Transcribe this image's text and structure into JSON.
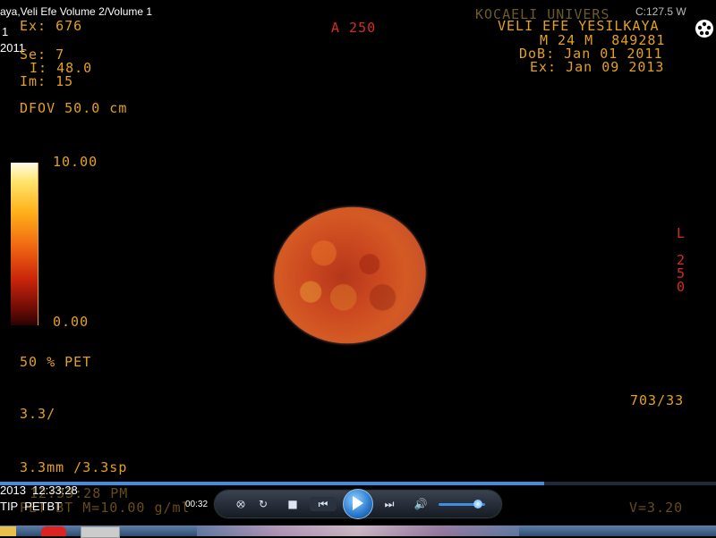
{
  "viewer": {
    "title_left": "aya,Veli Efe Volume 2/Volume 1",
    "institution": "KOCAELI UNIVERS",
    "window_level_fragment": "C:127.5 W",
    "exam_number": "Ex: 676",
    "series": "Se: 7",
    "image_index": "I: 48.0",
    "image_number": "Im: 15",
    "dfov": "DFOV 50.0 cm",
    "orientation_top": "A 250",
    "orientation_right_letter": "L",
    "orientation_right_digits": [
      "2",
      "5",
      "0"
    ],
    "patient_name": "VELI EFE YESILKAYA",
    "patient_info": "M 24 M  849281",
    "dob": "DoB: Jan 01 2011",
    "exam_date": "Ex: Jan 09 2013",
    "colorbar_max": "10.00",
    "colorbar_min": "0.00",
    "blend": "50 % PET",
    "thickness_partial": "3.3/",
    "thickness": "3.3mm /3.3sp",
    "matrix_ratio": "703/33",
    "time_ghost": "12:33:28 PM",
    "bottom_ghost": "PET BT M=10.00 g/ml",
    "v_value": "V=3.20"
  },
  "overlay_left": {
    "line_1": "1",
    "line_2": "2011",
    "timestamp": "2013  12:33:28",
    "series_label": "TIP  PETBT"
  },
  "player": {
    "elapsed": "00:32",
    "progress_fraction": 0.76,
    "volume_fraction": 0.85
  },
  "colors": {
    "overlay_text": "#e3a11c",
    "orientation_marker": "#d62d1f",
    "player_accent": "#3f8fe0"
  }
}
